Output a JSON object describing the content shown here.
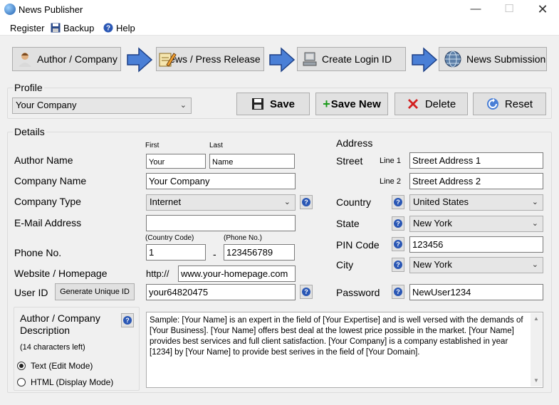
{
  "window": {
    "title": "News Publisher"
  },
  "menu": {
    "register": "Register",
    "backup": "Backup",
    "help": "Help"
  },
  "steps": {
    "author_company": "Author / Company",
    "news_press_release": "News / Press Release",
    "create_login_id": "Create Login ID",
    "news_submission": "News Submission"
  },
  "profile": {
    "label": "Profile",
    "selected": "Your Company",
    "save": "Save",
    "save_new": "Save New",
    "delete": "Delete",
    "reset": "Reset"
  },
  "details": {
    "label": "Details",
    "first_label": "First",
    "last_label": "Last",
    "author_name_label": "Author Name",
    "author_first": "Your",
    "author_last": "Name",
    "company_name_label": "Company Name",
    "company_name": "Your Company",
    "company_type_label": "Company Type",
    "company_type": "Internet",
    "email_label": "E-Mail Address",
    "email": "",
    "country_code_label": "(Country Code)",
    "phone_no_label_small": "(Phone No.)",
    "phone_label": "Phone No.",
    "country_code": "1",
    "phone_dash": "-",
    "phone": "123456789",
    "website_label": "Website / Homepage",
    "http_prefix": "http://",
    "website": "www.your-homepage.com",
    "user_id_label": "User ID",
    "generate_id": "Generate Unique ID",
    "user_id": "your64820475",
    "password_label": "Password",
    "password": "NewUser1234"
  },
  "address": {
    "label": "Address",
    "street_label": "Street",
    "line1_label": "Line 1",
    "line2_label": "Line 2",
    "line1": "Street Address 1",
    "line2": "Street Address 2",
    "country_label": "Country",
    "country": "United States",
    "state_label": "State",
    "state": "New York",
    "pin_label": "PIN Code",
    "pin": "123456",
    "city_label": "City",
    "city": "New York"
  },
  "description": {
    "label": "Author / Company Description",
    "chars_left": "(14 characters left)",
    "mode_text": "Text (Edit Mode)",
    "mode_html": "HTML (Display Mode)",
    "text": "Sample:  [Your Name] is an expert in the field of [Your Expertise] and is well versed with the demands of [Your Business]. [Your Name] offers best deal at the lowest price possible in the market. [Your Name] provides best services and full client satisfaction.  [Your Company] is a company established in year [1234] by [Your Name] to provide best serives in the field of [Your Domain]."
  },
  "colors": {
    "accent_arrow": "#4a7fd6",
    "help_icon": "#2a57b5",
    "delete_x": "#d32020"
  }
}
